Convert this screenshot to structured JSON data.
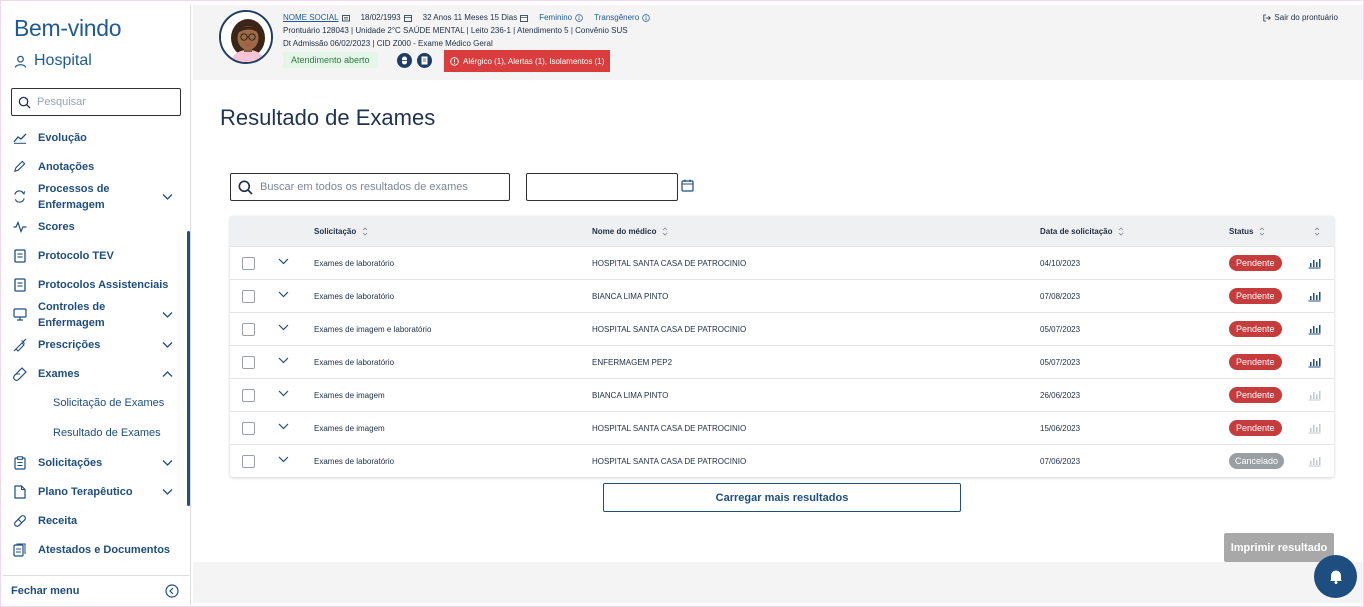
{
  "sidebar": {
    "welcome": "Bem-vindo",
    "hospital": "Hospital",
    "search_placeholder": "Pesquisar",
    "items": [
      {
        "label": "Evolução",
        "icon": "chart-line-icon"
      },
      {
        "label": "Anotações",
        "icon": "pencil-icon"
      },
      {
        "label": "Processos de Enfermagem",
        "icon": "sync-icon"
      },
      {
        "label": "Scores",
        "icon": "pulse-icon"
      },
      {
        "label": "Protocolo TEV",
        "icon": "document-icon"
      },
      {
        "label": "Protocolos Assistenciais",
        "icon": "document-icon"
      },
      {
        "label": "Controles de Enfermagem",
        "icon": "monitor-icon"
      },
      {
        "label": "Prescrições",
        "icon": "syringe-icon"
      },
      {
        "label": "Exames",
        "icon": "test-tube-icon"
      },
      {
        "label": "Solicitações",
        "icon": "clipboard-icon"
      },
      {
        "label": "Plano Terapêutico",
        "icon": "file-icon"
      },
      {
        "label": "Receita",
        "icon": "pill-icon"
      },
      {
        "label": "Atestados e Documentos",
        "icon": "documents-icon"
      }
    ],
    "sub_items": [
      "Solicitação de Exames",
      "Resultado de Exames"
    ],
    "footer": "Fechar menu"
  },
  "header": {
    "social_name": "NOME SOCIAL",
    "birth_date": "18/02/1993",
    "age": "32 Anos 11 Meses 15 Dias",
    "gender": "Feminino",
    "identity": "Transgênero",
    "line2": "Prontuário 128043  |  Unidade 2°C SAÚDE MENTAL  |  Leito 236-1  |  Atendimento 5  |  Convênio SUS",
    "line3": "Dt Admissão 06/02/2023  |  CID Z000 - Exame Médico Geral",
    "status": "Atendimento aberto",
    "alert": "Alérgico (1),  Alertas (1),  Isolamentos (1)",
    "logout": "Sair do prontuário"
  },
  "main": {
    "title": "Resultado de Exames",
    "search_placeholder": "Buscar em todos os resultados de exames",
    "columns": {
      "request": "Solicitação",
      "doctor": "Nome do médico",
      "date": "Data de solicitação",
      "status": "Status"
    },
    "rows": [
      {
        "request": "Exames de laboratório",
        "doctor": "HOSPITAL SANTA CASA DE PATROCINIO",
        "date": "04/10/2023",
        "status": "Pendente"
      },
      {
        "request": "Exames de laboratório",
        "doctor": "BIANCA LIMA PINTO",
        "date": "07/08/2023",
        "status": "Pendente"
      },
      {
        "request": "Exames de imagem e laboratório",
        "doctor": "HOSPITAL SANTA CASA DE PATROCINIO",
        "date": "05/07/2023",
        "status": "Pendente"
      },
      {
        "request": "Exames de laboratório",
        "doctor": "ENFERMAGEM PEP2",
        "date": "05/07/2023",
        "status": "Pendente"
      },
      {
        "request": "Exames de imagem",
        "doctor": "BIANCA LIMA PINTO",
        "date": "26/06/2023",
        "status": "Pendente"
      },
      {
        "request": "Exames de imagem",
        "doctor": "HOSPITAL SANTA CASA DE PATROCINIO",
        "date": "15/06/2023",
        "status": "Pendente"
      },
      {
        "request": "Exames de laboratório",
        "doctor": "HOSPITAL SANTA CASA DE PATROCINIO",
        "date": "07/06/2023",
        "status": "Cancelado"
      }
    ],
    "load_more": "Carregar mais resultados",
    "print": "Imprimir resultado"
  },
  "colors": {
    "primary": "#1e4d80",
    "pending": "#c63b3b",
    "cancelled": "#9a9fa4",
    "alert": "#d93d3d"
  }
}
